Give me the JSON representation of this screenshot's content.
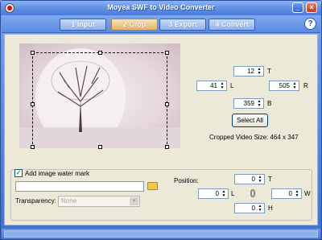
{
  "window": {
    "title": "Moyea SWF to Video Converter"
  },
  "steps": [
    {
      "number": "1",
      "label": "Input"
    },
    {
      "number": "2",
      "label": "Crop"
    },
    {
      "number": "3",
      "label": "Export"
    },
    {
      "number": "4",
      "label": "Convert"
    }
  ],
  "help": {
    "label": "?"
  },
  "crop": {
    "top": {
      "value": "12",
      "label": "T"
    },
    "left": {
      "value": "41",
      "label": "L"
    },
    "right": {
      "value": "505",
      "label": "R"
    },
    "bottom": {
      "value": "359",
      "label": "B"
    },
    "select_all_label": "Select All",
    "cropped_size_text": "Cropped Video Size: 464 x 347"
  },
  "watermark": {
    "checkbox_label": "Add image water mark",
    "checked": true,
    "file_value": "",
    "transparency_label": "Transparency:",
    "transparency_value": "None",
    "position_label": "Position:",
    "top": {
      "value": "0",
      "label": "T"
    },
    "left": {
      "value": "0",
      "label": "L"
    },
    "width": {
      "value": "0",
      "label": "W"
    },
    "height": {
      "value": "0",
      "label": "H"
    }
  },
  "icons": {
    "spin_up": "▲",
    "spin_down": "▼",
    "check": "✓",
    "dropdown": "▼",
    "minimize": "_",
    "close": "×"
  }
}
